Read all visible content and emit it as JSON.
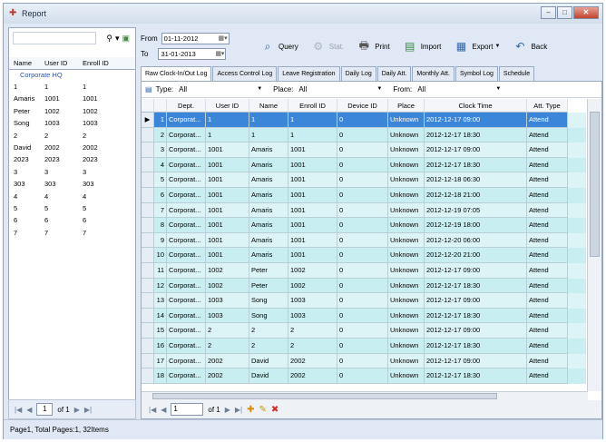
{
  "window": {
    "title": "Report",
    "min": "–",
    "max": "□",
    "close": "✕"
  },
  "left": {
    "headers": [
      "Name",
      "User ID",
      "Enroll ID"
    ],
    "group": "Corporate HQ",
    "rows": [
      [
        "1",
        "1",
        "1"
      ],
      [
        "Amaris",
        "1001",
        "1001"
      ],
      [
        "Peter",
        "1002",
        "1002"
      ],
      [
        "Song",
        "1003",
        "1003"
      ],
      [
        "2",
        "2",
        "2"
      ],
      [
        "David",
        "2002",
        "2002"
      ],
      [
        "2023",
        "2023",
        "2023"
      ],
      [
        "3",
        "3",
        "3"
      ],
      [
        "303",
        "303",
        "303"
      ],
      [
        "4",
        "4",
        "4"
      ],
      [
        "5",
        "5",
        "5"
      ],
      [
        "6",
        "6",
        "6"
      ],
      [
        "7",
        "7",
        "7"
      ]
    ],
    "pager": {
      "page": "1",
      "of": "of 1"
    }
  },
  "dates": {
    "from_label": "From",
    "from": "01-11-2012",
    "to_label": "To",
    "to": "31-01-2013"
  },
  "toolbar": {
    "query": "Query",
    "stat": "Stat.",
    "print": "Print",
    "import": "Import",
    "export": "Export",
    "back": "Back"
  },
  "tabs": [
    "Raw Clock-In/Out Log",
    "Access Control Log",
    "Leave Registration",
    "Daily Log",
    "Daily Att.",
    "Monthly Att.",
    "Symbol Log",
    "Schedule"
  ],
  "filters": {
    "type_label": "Type:",
    "type": "All",
    "place_label": "Place:",
    "place": "All",
    "from_label": "From:",
    "from": "All"
  },
  "grid": {
    "headers": [
      "",
      "",
      "Dept.",
      "User ID",
      "Name",
      "Enroll ID",
      "Device ID",
      "Place",
      "Clock Time",
      "Att. Type"
    ],
    "rows": [
      [
        "1",
        "Corporat...",
        "1",
        "1",
        "1",
        "0",
        "Unknown",
        "2012-12-17 09:00",
        "Attend"
      ],
      [
        "2",
        "Corporat...",
        "1",
        "1",
        "1",
        "0",
        "Unknown",
        "2012-12-17 18:30",
        "Attend"
      ],
      [
        "3",
        "Corporat...",
        "1001",
        "Amaris",
        "1001",
        "0",
        "Unknown",
        "2012-12-17 09:00",
        "Attend"
      ],
      [
        "4",
        "Corporat...",
        "1001",
        "Amaris",
        "1001",
        "0",
        "Unknown",
        "2012-12-17 18:30",
        "Attend"
      ],
      [
        "5",
        "Corporat...",
        "1001",
        "Amaris",
        "1001",
        "0",
        "Unknown",
        "2012-12-18 06:30",
        "Attend"
      ],
      [
        "6",
        "Corporat...",
        "1001",
        "Amaris",
        "1001",
        "0",
        "Unknown",
        "2012-12-18 21:00",
        "Attend"
      ],
      [
        "7",
        "Corporat...",
        "1001",
        "Amaris",
        "1001",
        "0",
        "Unknown",
        "2012-12-19 07:05",
        "Attend"
      ],
      [
        "8",
        "Corporat...",
        "1001",
        "Amaris",
        "1001",
        "0",
        "Unknown",
        "2012-12-19 18:00",
        "Attend"
      ],
      [
        "9",
        "Corporat...",
        "1001",
        "Amaris",
        "1001",
        "0",
        "Unknown",
        "2012-12-20 06:00",
        "Attend"
      ],
      [
        "10",
        "Corporat...",
        "1001",
        "Amaris",
        "1001",
        "0",
        "Unknown",
        "2012-12-20 21:00",
        "Attend"
      ],
      [
        "11",
        "Corporat...",
        "1002",
        "Peter",
        "1002",
        "0",
        "Unknown",
        "2012-12-17 09:00",
        "Attend"
      ],
      [
        "12",
        "Corporat...",
        "1002",
        "Peter",
        "1002",
        "0",
        "Unknown",
        "2012-12-17 18:30",
        "Attend"
      ],
      [
        "13",
        "Corporat...",
        "1003",
        "Song",
        "1003",
        "0",
        "Unknown",
        "2012-12-17 09:00",
        "Attend"
      ],
      [
        "14",
        "Corporat...",
        "1003",
        "Song",
        "1003",
        "0",
        "Unknown",
        "2012-12-17 18:30",
        "Attend"
      ],
      [
        "15",
        "Corporat...",
        "2",
        "2",
        "2",
        "0",
        "Unknown",
        "2012-12-17 09:00",
        "Attend"
      ],
      [
        "16",
        "Corporat...",
        "2",
        "2",
        "2",
        "0",
        "Unknown",
        "2012-12-17 18:30",
        "Attend"
      ],
      [
        "17",
        "Corporat...",
        "2002",
        "David",
        "2002",
        "0",
        "Unknown",
        "2012-12-17 09:00",
        "Attend"
      ],
      [
        "18",
        "Corporat...",
        "2002",
        "David",
        "2002",
        "0",
        "Unknown",
        "2012-12-17 18:30",
        "Attend"
      ]
    ],
    "pager": {
      "page": "1",
      "of": "of 1"
    }
  },
  "status": "Page1, Total Pages:1, 32Items"
}
